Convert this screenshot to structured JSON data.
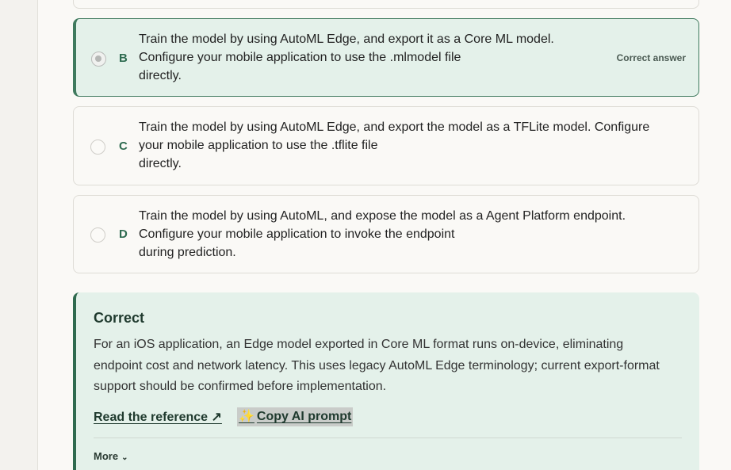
{
  "options": [
    {
      "letter": "B",
      "lines": [
        "Train the model by using AutoML Edge, and export it as a Core ML model.",
        "Configure your mobile application to use the .mlmodel file",
        "directly."
      ],
      "selected": true,
      "correct_label": "Correct answer"
    },
    {
      "letter": "C",
      "lines": [
        "Train the model by using AutoML Edge, and export the model as a TFLite model. Configure",
        "your mobile application to use the .tflite file",
        "directly."
      ],
      "selected": false
    },
    {
      "letter": "D",
      "lines": [
        "Train the model by using AutoML, and expose the model as a Agent Platform endpoint.",
        "Configure your mobile application to invoke the endpoint",
        "during prediction."
      ],
      "selected": false
    }
  ],
  "explanation": {
    "title": "Correct",
    "lines": [
      "For an iOS application, an Edge model exported in Core ML format runs on-device, eliminating",
      "endpoint cost and network latency. This uses legacy AutoML Edge terminology; current export-format",
      "support should be confirmed before implementation."
    ],
    "reference_link": "Read the reference ↗",
    "ai_prompt_icon": "sparkles-icon",
    "ai_prompt_label": "Copy AI prompt",
    "more_label": "More",
    "more_chevron": "⌄"
  },
  "colors": {
    "accent": "#2e6b50",
    "correct_bg": "#e4f1ea",
    "page_bg": "#faf9f6"
  }
}
